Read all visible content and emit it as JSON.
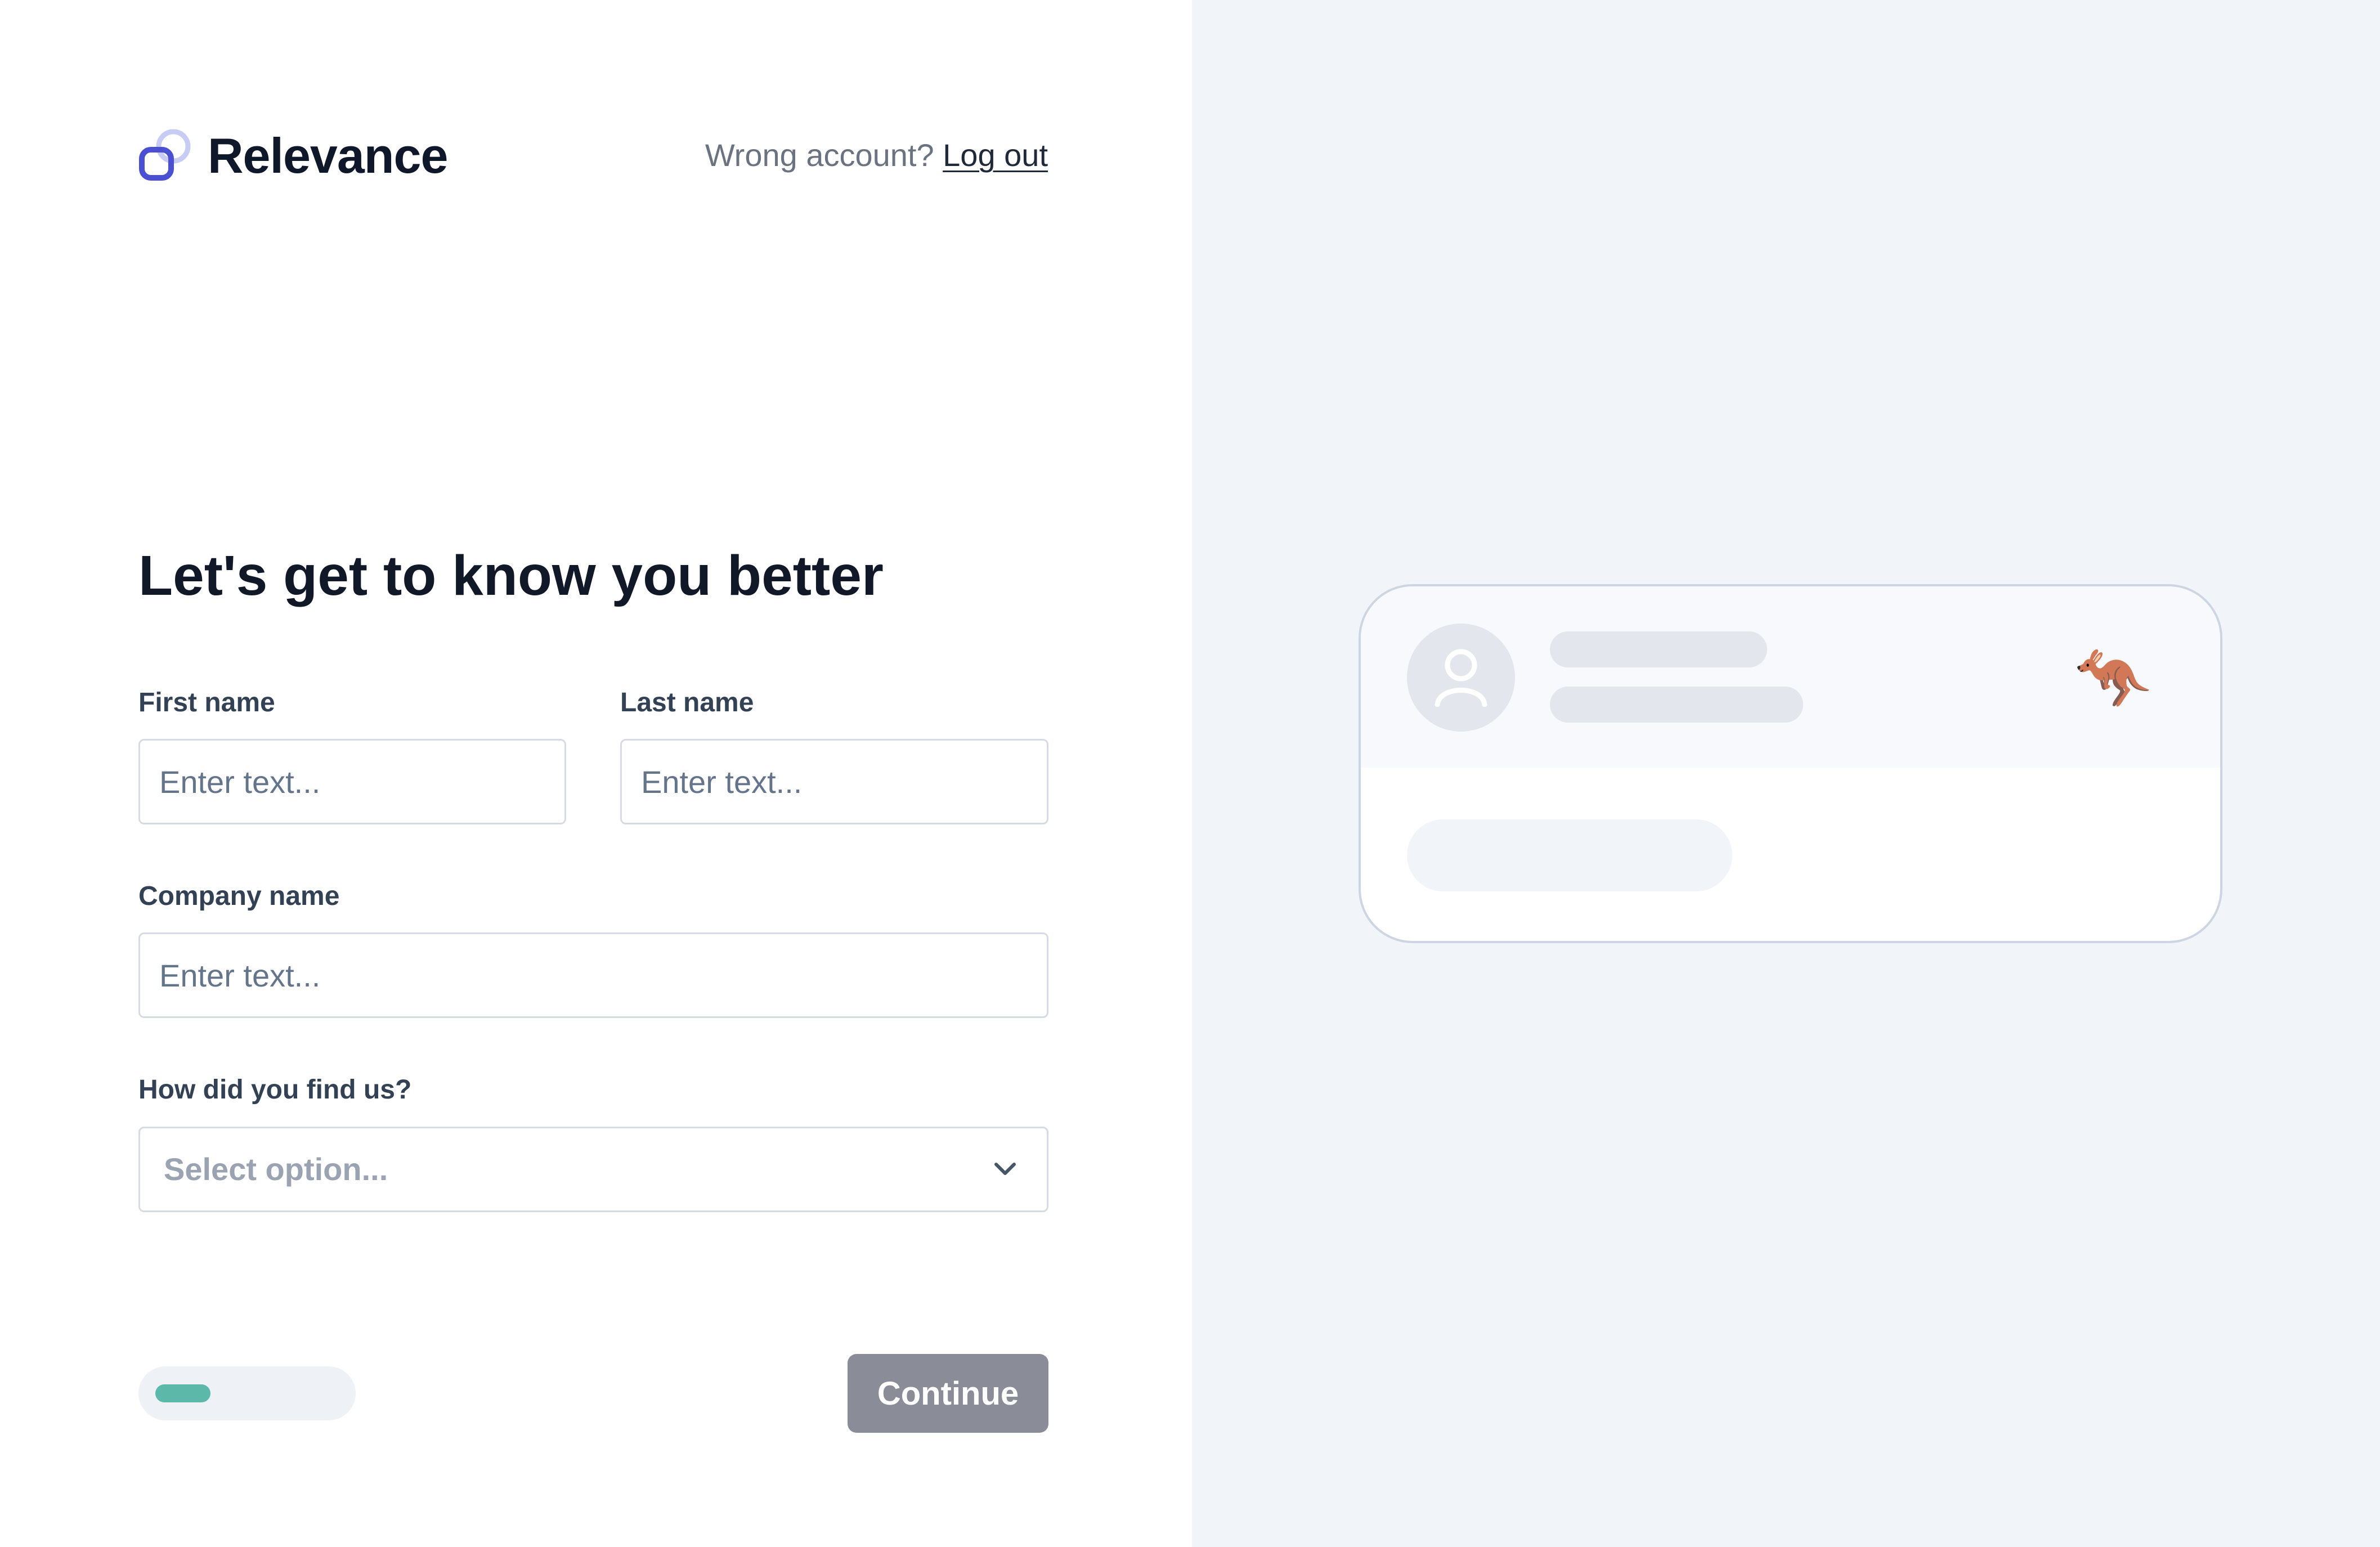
{
  "app": {
    "brand_name": "Relevance",
    "account_prompt": "Wrong account?",
    "logout_label": "Log out"
  },
  "form": {
    "title": "Let's get to know you better",
    "first_name": {
      "label": "First name",
      "placeholder": "Enter text...",
      "value": ""
    },
    "last_name": {
      "label": "Last name",
      "placeholder": "Enter text...",
      "value": ""
    },
    "company_name": {
      "label": "Company name",
      "placeholder": "Enter text...",
      "value": ""
    },
    "referral_source": {
      "label": "How did you find us?",
      "placeholder": "Select option...",
      "selected": ""
    }
  },
  "footer": {
    "progress_fraction": 0.3,
    "continue_label": "Continue"
  },
  "preview": {
    "mascot_glyph": "🦘"
  },
  "colors": {
    "brand_primary": "#4b4fd1",
    "brand_secondary": "#c7ccf5",
    "progress_fill": "#5cb8a8",
    "button_disabled": "#8a8d97",
    "right_panel_bg": "#f1f4f9"
  },
  "icons": {
    "logo": "relevance-logo-icon",
    "dropdown": "chevron-down-icon",
    "avatar": "user-icon",
    "mascot": "kangaroo-icon"
  }
}
